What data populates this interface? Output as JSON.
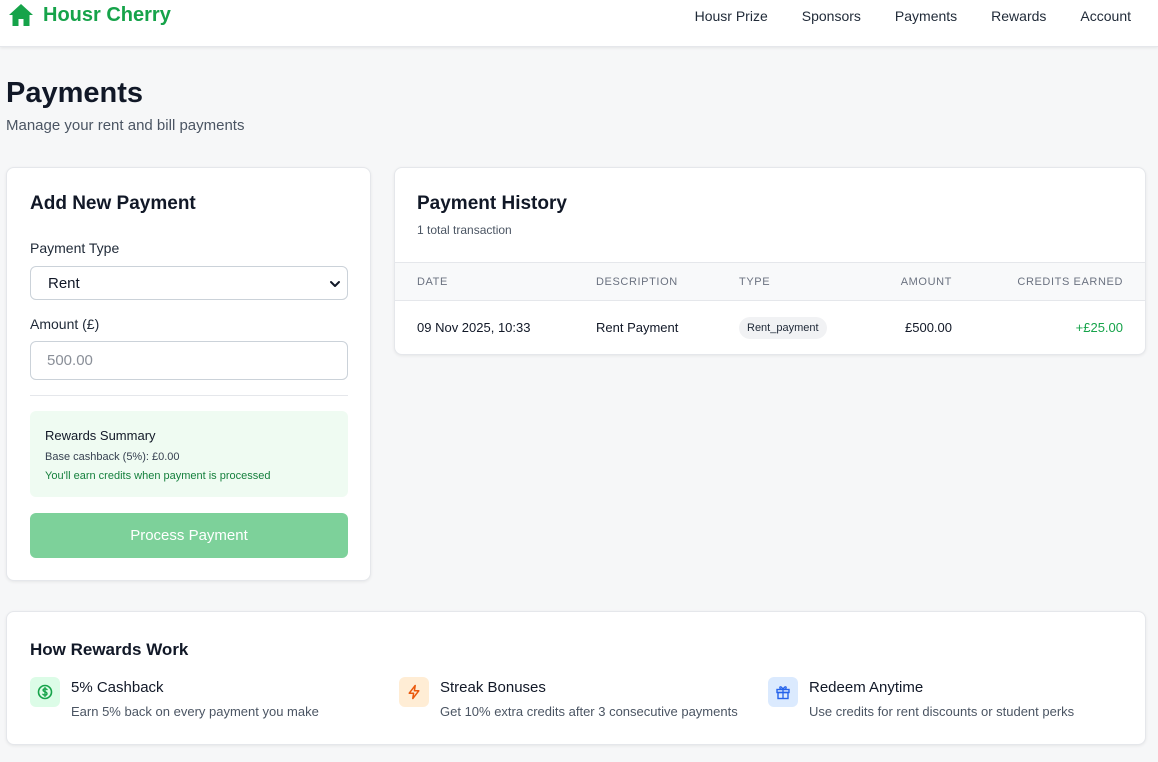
{
  "nav": {
    "brand": "Housr Cherry",
    "brand_icon": "home-icon",
    "brand_color": "#16a34a",
    "links": [
      "Housr Prize",
      "Sponsors",
      "Payments",
      "Rewards",
      "Account"
    ]
  },
  "page": {
    "title": "Payments",
    "subtitle": "Manage your rent and bill payments"
  },
  "add_payment": {
    "heading": "Add New Payment",
    "type_label": "Payment Type",
    "type_value": "Rent",
    "amount_label": "Amount (£)",
    "amount_placeholder": "500.00",
    "rewards_title": "Rewards Summary",
    "rewards_base": "Base cashback (5%): £0.00",
    "rewards_note": "You'll earn credits when payment is processed",
    "button_label": "Process Payment",
    "button_color": "#7dd19a"
  },
  "history": {
    "heading": "Payment History",
    "count_text": "1 total transaction",
    "columns": [
      "Date",
      "Description",
      "Type",
      "Amount",
      "Credits Earned"
    ],
    "rows": [
      {
        "date": "09 Nov 2025, 10:33",
        "description": "Rent Payment",
        "type": "Rent_payment",
        "amount": "£500.00",
        "credits": "+£25.00"
      }
    ]
  },
  "how_rewards": {
    "heading": "How Rewards Work",
    "features": [
      {
        "icon": "dollar-circle-icon",
        "title": "5% Cashback",
        "description": "Earn 5% back on every payment you make",
        "icon_color": "#16a34a",
        "icon_bg": "#dcfce7"
      },
      {
        "icon": "lightning-icon",
        "title": "Streak Bonuses",
        "description": "Get 10% extra credits after 3 consecutive payments",
        "icon_color": "#ea580c",
        "icon_bg": "#ffedd5"
      },
      {
        "icon": "gift-icon",
        "title": "Redeem Anytime",
        "description": "Use credits for rent discounts or student perks",
        "icon_color": "#2563eb",
        "icon_bg": "#dbeafe"
      }
    ]
  }
}
